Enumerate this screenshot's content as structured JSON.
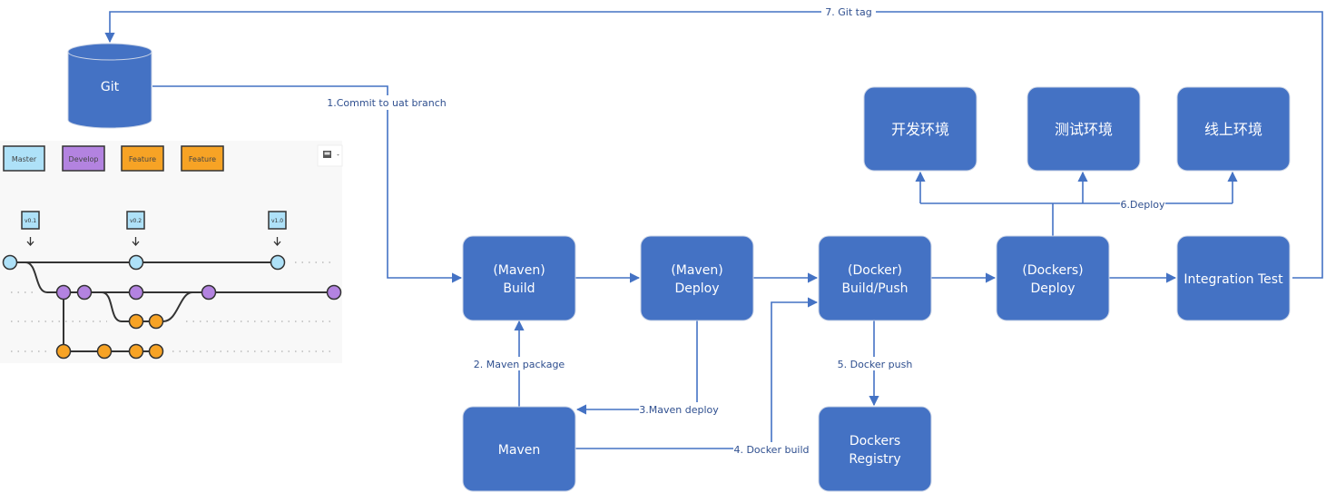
{
  "diagram": {
    "nodes": {
      "git": "Git",
      "maven_build": [
        "(Maven)",
        "Build"
      ],
      "maven_deploy": [
        "(Maven)",
        "Deploy"
      ],
      "docker_build_push": [
        "(Docker)",
        "Build/Push"
      ],
      "dockers_deploy": [
        "(Dockers)",
        "Deploy"
      ],
      "integration_test": "Integration Test",
      "maven": "Maven",
      "dockers_registry": [
        "Dockers",
        "Registry"
      ],
      "env_dev": "开发环境",
      "env_test": "测试环境",
      "env_prod": "线上环境"
    },
    "edges": {
      "commit": "1.Commit to uat branch",
      "maven_package": "2. Maven package",
      "maven_deploy": "3.Maven deploy",
      "docker_build": "4. Docker build",
      "docker_push": "5. Docker push",
      "deploy": "6.Deploy",
      "git_tag": "7. Git tag"
    },
    "colors": {
      "node_fill": "#4472C4",
      "connector": "#4472C4",
      "master": "#AEE1F8",
      "develop": "#B383E0",
      "feature": "#F7A325"
    }
  },
  "gitflow": {
    "legend": [
      "Master",
      "Develop",
      "Feature",
      "Feature"
    ],
    "tags": [
      "v0.1",
      "v0.2",
      "v1.0"
    ],
    "toolbar_icon": "image-icon"
  }
}
